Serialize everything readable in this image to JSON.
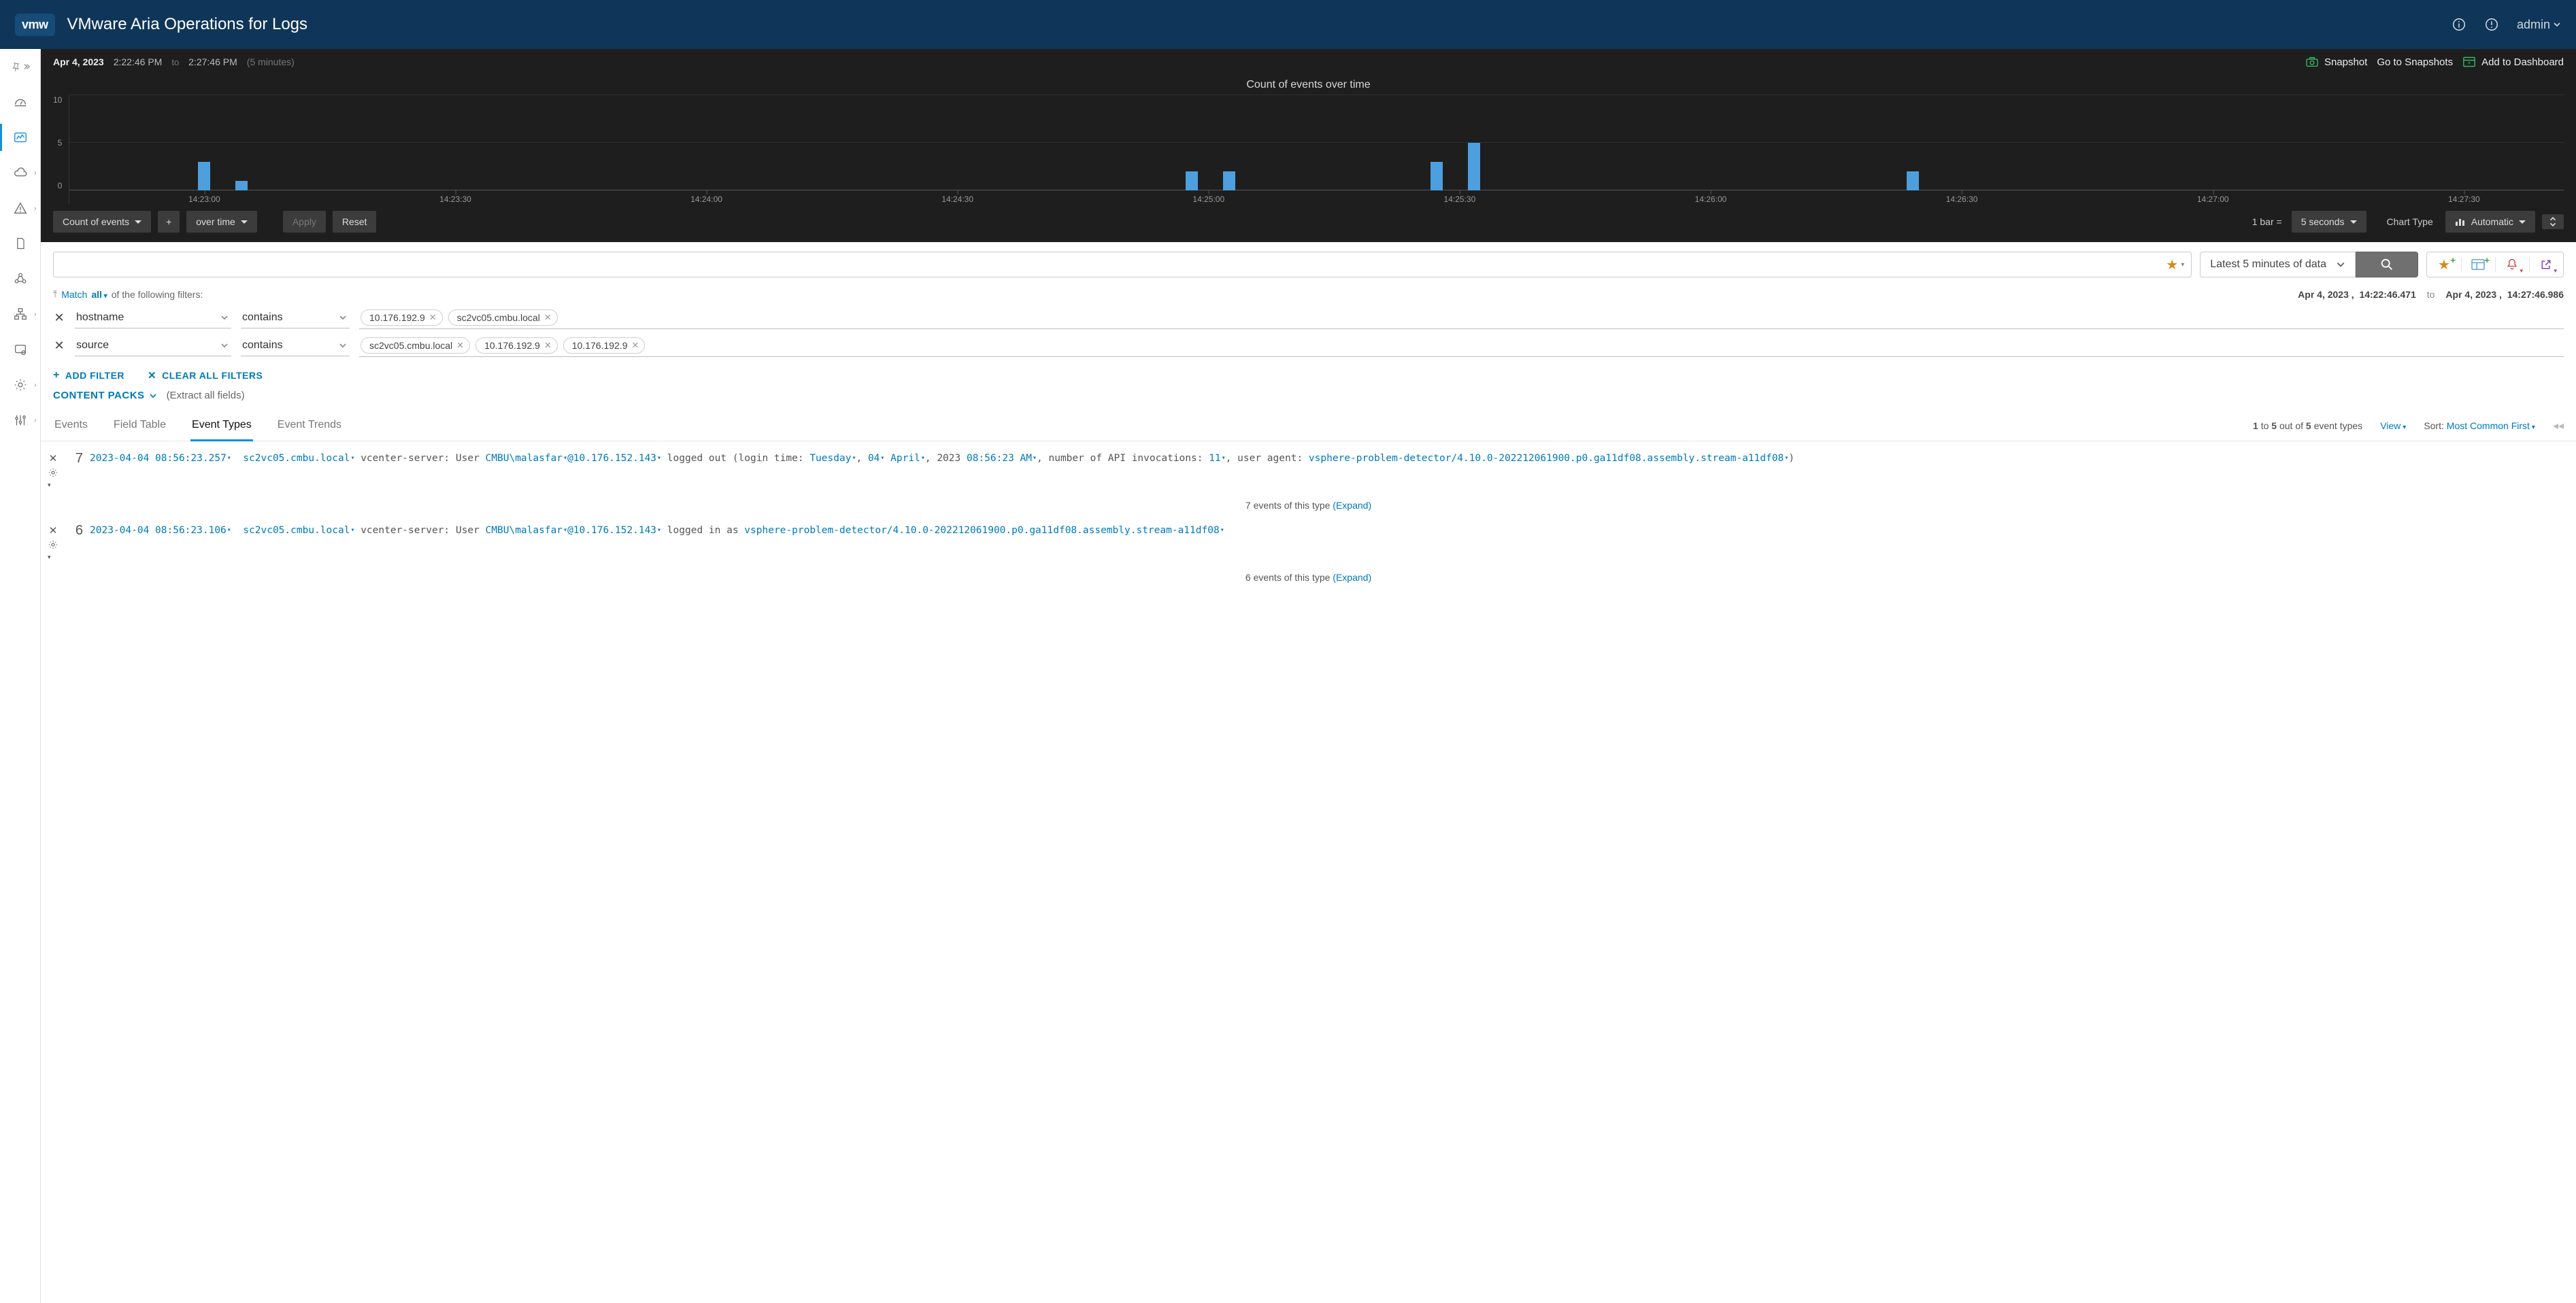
{
  "header": {
    "logo": "vmw",
    "title": "VMware Aria Operations for Logs",
    "user": "admin"
  },
  "time_bar": {
    "date": "Apr 4, 2023",
    "from": "2:22:46 PM",
    "sep": "to",
    "to": "2:27:46 PM",
    "span": "(5 minutes)",
    "snapshot": "Snapshot",
    "go": "Go to Snapshots",
    "add": "Add to Dashboard"
  },
  "chart_controls": {
    "count": "Count of events",
    "over": "over time",
    "apply": "Apply",
    "reset": "Reset",
    "bar_eq": "1 bar =",
    "bar_val": "5 seconds",
    "chart_type_lbl": "Chart Type",
    "chart_type": "Automatic"
  },
  "chart_data": {
    "type": "bar",
    "title": "Count of events over time",
    "ylabel": "",
    "xlabel": "",
    "ylim": [
      0,
      10
    ],
    "y_ticks": [
      10,
      5,
      0
    ],
    "x_ticks": [
      "14:23:00",
      "14:23:30",
      "14:24:00",
      "14:24:30",
      "14:25:00",
      "14:25:30",
      "14:26:00",
      "14:26:30",
      "14:27:00",
      "14:27:30"
    ],
    "bars": [
      {
        "x_pct": 5.4,
        "value": 3
      },
      {
        "x_pct": 6.9,
        "value": 1
      },
      {
        "x_pct": 45.0,
        "value": 2
      },
      {
        "x_pct": 46.5,
        "value": 2
      },
      {
        "x_pct": 54.8,
        "value": 3
      },
      {
        "x_pct": 56.3,
        "value": 5
      },
      {
        "x_pct": 73.9,
        "value": 2
      }
    ]
  },
  "search": {
    "placeholder": "",
    "time_label": "Latest 5 minutes of data"
  },
  "filter_header": {
    "arrow": "⇵",
    "match": "Match",
    "mode": "all",
    "of": "of the following filters:",
    "range_from_date": "Apr 4, 2023 ,",
    "range_from_time": "14:22:46.471",
    "to": "to",
    "range_to_date": "Apr 4, 2023 ,",
    "range_to_time": "14:27:46.986"
  },
  "filters": [
    {
      "field": "hostname",
      "op": "contains",
      "chips": [
        "10.176.192.9",
        "sc2vc05.cmbu.local"
      ]
    },
    {
      "field": "source",
      "op": "contains",
      "chips": [
        "sc2vc05.cmbu.local",
        "10.176.192.9",
        "10.176.192.9"
      ]
    }
  ],
  "filter_actions": {
    "add": "ADD FILTER",
    "clear": "CLEAR ALL FILTERS"
  },
  "content_packs": {
    "label": "CONTENT PACKS",
    "note": "(Extract all fields)"
  },
  "tabs": {
    "items": [
      "Events",
      "Field Table",
      "Event Types",
      "Event Trends"
    ],
    "active": 2,
    "summary_prefix": "1",
    "summary_mid": " to ",
    "summary_to": "5",
    "summary_mid2": " out of ",
    "summary_total": "5",
    "summary_suffix": " event types",
    "view": "View",
    "sort_lbl": "Sort:",
    "sort_val": "Most Common First"
  },
  "event_types": [
    {
      "count": "7",
      "ts": "2023-04-04 08:56:23.257",
      "host": "sc2vc05.cmbu.local",
      "svc": "vcenter-server: User",
      "user": "CMBU\\malasfar",
      "at": "@",
      "ip": "10.176.152.143",
      "mid1": "logged out (login time:",
      "day": "Tuesday",
      "sep1": ",",
      "dn": "04",
      "mon": "April",
      "sep2": ", 2023",
      "ltime": "08:56:23 AM",
      "mid2": ", number of API invocations:",
      "inv": "11",
      "mid3": ", user agent:",
      "ua": "vsphere-problem-detector/4.10.0-202212061900.p0.ga11df08.assembly.stream-a11df08",
      "tail": ")",
      "expand_n": "7 events of this type",
      "expand": "(Expand)"
    },
    {
      "count": "6",
      "ts": "2023-04-04 08:56:23.106",
      "host": "sc2vc05.cmbu.local",
      "svc": "vcenter-server: User",
      "user": "CMBU\\malasfar",
      "at": "@",
      "ip": "10.176.152.143",
      "mid1": "logged in as",
      "ua": "vsphere-problem-detector/4.10.0-202212061900.p0.ga11df08.assembly.stream-a11df08",
      "expand_n": "6 events of this type",
      "expand": "(Expand)"
    }
  ]
}
